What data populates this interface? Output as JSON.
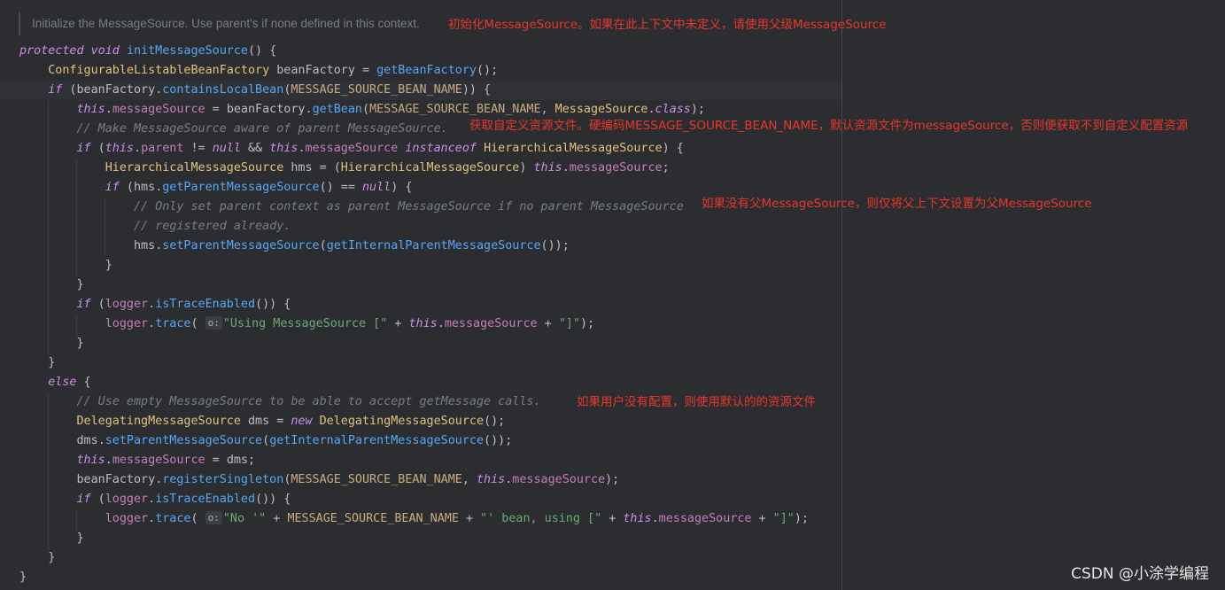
{
  "doc_comment": "Initialize the MessageSource. Use parent's if none defined in this context.",
  "annotations": {
    "a1": "初始化MessageSource。如果在此上下文中未定义，请使用父级MessageSource",
    "a2": "获取自定义资源文件。硬编码MESSAGE_SOURCE_BEAN_NAME，默认资源文件为messageSource，否则便获取不到自定义配置资源",
    "a3": "如果没有父MessageSource，则仅将父上下文设置为父MessageSource",
    "a4": "如果用户没有配置，则使用默认的的资源文件"
  },
  "code": {
    "kw_protected": "protected",
    "kw_void": "void",
    "kw_if": "if",
    "kw_else": "else",
    "kw_this": "this",
    "kw_null": "null",
    "kw_class": "class",
    "kw_instanceof": "instanceof",
    "kw_new": "new",
    "m_initMessageSource": "initMessageSource",
    "m_getBeanFactory": "getBeanFactory",
    "m_containsLocalBean": "containsLocalBean",
    "m_getBean": "getBean",
    "m_getParentMessageSource": "getParentMessageSource",
    "m_setParentMessageSource": "setParentMessageSource",
    "m_getInternalParentMessageSource": "getInternalParentMessageSource",
    "m_isTraceEnabled": "isTraceEnabled",
    "m_trace": "trace",
    "m_registerSingleton": "registerSingleton",
    "t_ConfigurableListableBeanFactory": "ConfigurableListableBeanFactory",
    "t_MessageSource": "MessageSource",
    "t_HierarchicalMessageSource": "HierarchicalMessageSource",
    "t_DelegatingMessageSource": "DelegatingMessageSource",
    "v_beanFactory": "beanFactory",
    "v_hms": "hms",
    "v_dms": "dms",
    "f_messageSource": "messageSource",
    "f_parent": "parent",
    "f_logger": "logger",
    "c_MESSAGE_SOURCE_BEAN_NAME": "MESSAGE_SOURCE_BEAN_NAME",
    "cm_make_aware": "// Make MessageSource aware of parent MessageSource.",
    "cm_only_set": "// Only set parent context as parent MessageSource if no parent MessageSource",
    "cm_registered": "// registered already.",
    "cm_use_empty": "// Use empty MessageSource to be able to accept getMessage calls.",
    "s_using": "\"Using MessageSource [\"",
    "s_close": "\"]\"",
    "s_no": "\"No '\"",
    "s_bean_using": "\"' bean, using [\"",
    "hint_o": "o:"
  },
  "watermark": "CSDN @小涂学编程"
}
